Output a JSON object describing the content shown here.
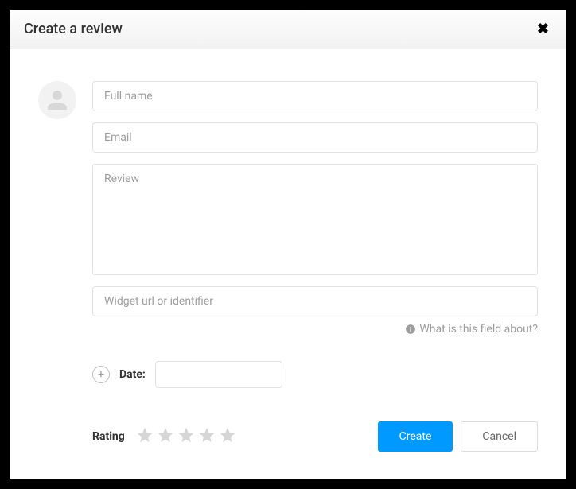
{
  "header": {
    "title": "Create a review"
  },
  "form": {
    "full_name_placeholder": "Full name",
    "email_placeholder": "Email",
    "review_placeholder": "Review",
    "widget_placeholder": "Widget url or identifier",
    "widget_hint": "What is this field about?",
    "date_label": "Date:",
    "rating_label": "Rating"
  },
  "actions": {
    "create_label": "Create",
    "cancel_label": "Cancel"
  }
}
